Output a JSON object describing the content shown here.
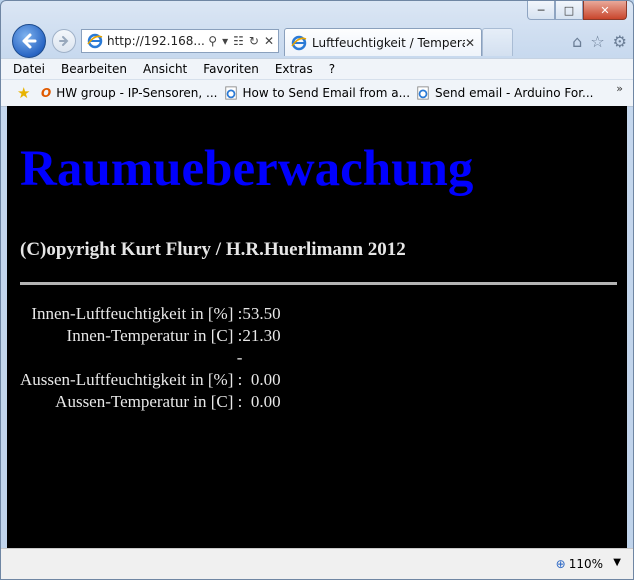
{
  "browser": {
    "address_url": "http://192.168...",
    "tab_title": "Luftfeuchtigkeit / Temperat...",
    "menu": [
      "Datei",
      "Bearbeiten",
      "Ansicht",
      "Favoriten",
      "Extras",
      "?"
    ],
    "favorites": [
      {
        "label": "HW group - IP-Sensoren, ...",
        "icon": "opera-o-icon"
      },
      {
        "label": "How to Send Email from a...",
        "icon": "ie-page-icon"
      },
      {
        "label": "Send email - Arduino For...",
        "icon": "ie-page-icon"
      }
    ],
    "zoom": "110%"
  },
  "page": {
    "heading": "Raumueberwachung",
    "copyright": "(C)opyright Kurt Flury / H.R.Huerlimann 2012",
    "readings": [
      {
        "label": "Innen-Luftfeuchtigkeit in [%] :",
        "value": "53.50"
      },
      {
        "label": "Innen-Temperatur in [C] :",
        "value": "21.30"
      },
      {
        "label": "-",
        "value": ""
      },
      {
        "label": "Aussen-Luftfeuchtigkeit in [%] :",
        "value": "0.00"
      },
      {
        "label": "Aussen-Temperatur in [C] :",
        "value": "0.00"
      }
    ]
  },
  "colors": {
    "heading": "#0000ff",
    "background": "#000000",
    "text": "#e8e8e8"
  }
}
